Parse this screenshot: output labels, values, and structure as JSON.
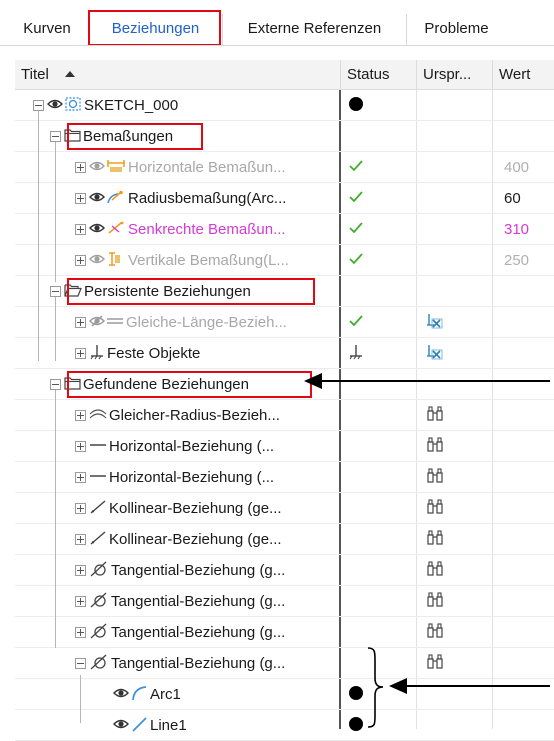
{
  "tabs": [
    {
      "label": "Kurven",
      "active": false
    },
    {
      "label": "Beziehungen",
      "active": true
    },
    {
      "label": "Externe Referenzen",
      "active": false
    },
    {
      "label": "Probleme",
      "active": false
    }
  ],
  "columns": {
    "title": "Titel",
    "status": "Status",
    "origin": "Urspr...",
    "value": "Wert"
  },
  "rows": [
    {
      "label": "SKETCH_000",
      "status": "dot",
      "origin": "",
      "value": ""
    },
    {
      "label": "Bemaßungen",
      "status": "",
      "origin": "",
      "value": ""
    },
    {
      "label": "Horizontale Bemaßun...",
      "status": "check",
      "origin": "",
      "value": "400"
    },
    {
      "label": "Radiusbemaßung(Arc...",
      "status": "check",
      "origin": "",
      "value": "60"
    },
    {
      "label": "Senkrechte Bemaßun...",
      "status": "check",
      "origin": "",
      "value": "310"
    },
    {
      "label": "Vertikale Bemaßung(L...",
      "status": "check",
      "origin": "",
      "value": "250"
    },
    {
      "label": "Persistente Beziehungen",
      "status": "",
      "origin": "",
      "value": ""
    },
    {
      "label": "Gleiche-Länge-Bezieh...",
      "status": "check",
      "origin": "fixed-icon",
      "value": ""
    },
    {
      "label": "Feste Objekte",
      "status": "anchor",
      "origin": "fixed-icon",
      "value": ""
    },
    {
      "label": "Gefundene Beziehungen",
      "status": "",
      "origin": "",
      "value": ""
    },
    {
      "label": "Gleicher-Radius-Bezieh...",
      "status": "",
      "origin": "binoculars",
      "value": ""
    },
    {
      "label": "Horizontal-Beziehung (...",
      "status": "",
      "origin": "binoculars",
      "value": ""
    },
    {
      "label": "Horizontal-Beziehung (...",
      "status": "",
      "origin": "binoculars",
      "value": ""
    },
    {
      "label": "Kollinear-Beziehung (ge...",
      "status": "",
      "origin": "binoculars",
      "value": ""
    },
    {
      "label": "Kollinear-Beziehung (ge...",
      "status": "",
      "origin": "binoculars",
      "value": ""
    },
    {
      "label": "Tangential-Beziehung (g...",
      "status": "",
      "origin": "binoculars",
      "value": ""
    },
    {
      "label": "Tangential-Beziehung (g...",
      "status": "",
      "origin": "binoculars",
      "value": ""
    },
    {
      "label": "Tangential-Beziehung (g...",
      "status": "",
      "origin": "binoculars",
      "value": ""
    },
    {
      "label": "Tangential-Beziehung (g...",
      "status": "",
      "origin": "binoculars",
      "value": ""
    },
    {
      "label": "Arc1",
      "status": "dot",
      "origin": "",
      "value": ""
    },
    {
      "label": "Line1",
      "status": "dot",
      "origin": "",
      "value": ""
    }
  ],
  "colors": {
    "highlight": "#e30613",
    "active_tab": "#1f63c4",
    "check": "#3fae2a",
    "dim_text": "#a8a8a8",
    "pink_text": "#d43ad6",
    "value_dim": "#b0b0b0",
    "value_pink": "#d43ad6"
  }
}
